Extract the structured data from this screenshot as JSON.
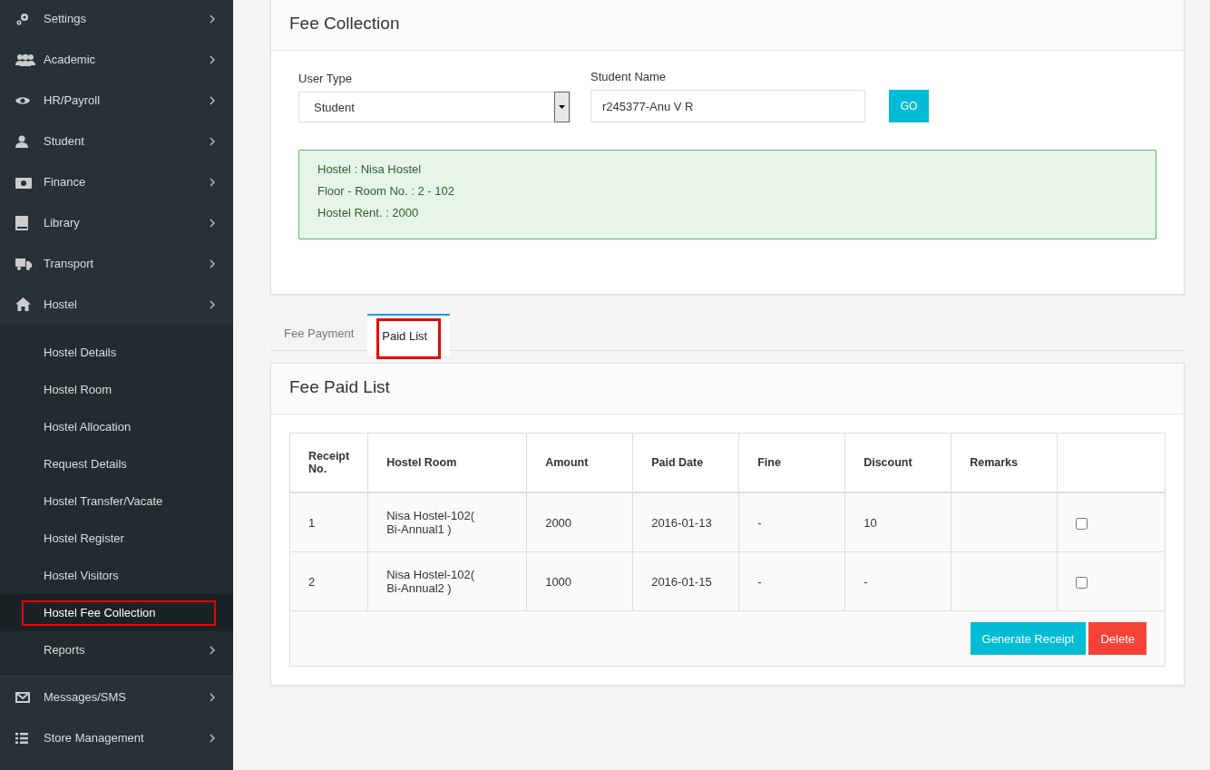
{
  "sidebar": {
    "items": [
      {
        "label": "Settings"
      },
      {
        "label": "Academic"
      },
      {
        "label": "HR/Payroll"
      },
      {
        "label": "Student"
      },
      {
        "label": "Finance"
      },
      {
        "label": "Library"
      },
      {
        "label": "Transport"
      },
      {
        "label": "Hostel",
        "children": [
          {
            "label": "Hostel Details",
            "selected": false,
            "highlighted": false,
            "has_arrow": false
          },
          {
            "label": "Hostel Room",
            "selected": false,
            "highlighted": false,
            "has_arrow": false
          },
          {
            "label": "Hostel Allocation",
            "selected": false,
            "highlighted": false,
            "has_arrow": false
          },
          {
            "label": "Request Details",
            "selected": false,
            "highlighted": false,
            "has_arrow": false
          },
          {
            "label": "Hostel Transfer/Vacate",
            "selected": false,
            "highlighted": false,
            "has_arrow": false
          },
          {
            "label": "Hostel Register",
            "selected": false,
            "highlighted": false,
            "has_arrow": false
          },
          {
            "label": "Hostel Visitors",
            "selected": false,
            "highlighted": false,
            "has_arrow": false
          },
          {
            "label": "Hostel Fee Collection",
            "selected": true,
            "highlighted": true,
            "has_arrow": false
          },
          {
            "label": "Reports",
            "selected": false,
            "highlighted": false,
            "has_arrow": true
          }
        ]
      },
      {
        "label": "Messages/SMS"
      },
      {
        "label": "Store Management"
      }
    ]
  },
  "fee_collection": {
    "title": "Fee Collection",
    "user_type": {
      "label": "User Type",
      "value": "Student"
    },
    "student_name": {
      "label": "Student Name",
      "value": "r245377-Anu V R"
    },
    "go_button": "GO",
    "info": [
      "Hostel : Nisa Hostel",
      "Floor - Room No. : 2 - 102",
      "Hostel Rent. : 2000"
    ]
  },
  "tabs": [
    {
      "label": "Fee Payment",
      "selected": false,
      "highlighted": false
    },
    {
      "label": "Paid List",
      "selected": true,
      "highlighted": true
    }
  ],
  "paid_list": {
    "title": "Fee Paid List",
    "columns": [
      "Receipt No.",
      "Hostel Room",
      "Amount",
      "Paid Date",
      "Fine",
      "Discount",
      "Remarks"
    ],
    "rows": [
      {
        "cells": [
          "1",
          "Nisa Hostel-102( Bi-Annual1 )",
          "2000",
          "2016-01-13",
          "-",
          "10",
          ""
        ],
        "checked": false
      },
      {
        "cells": [
          "2",
          "Nisa Hostel-102( Bi-Annual2 )",
          "1000",
          "2016-01-15",
          "-",
          "-",
          ""
        ],
        "checked": false
      }
    ],
    "buttons": [
      {
        "label": "Generate Receipt",
        "kind": "primary"
      },
      {
        "label": "Delete",
        "kind": "danger"
      }
    ]
  }
}
